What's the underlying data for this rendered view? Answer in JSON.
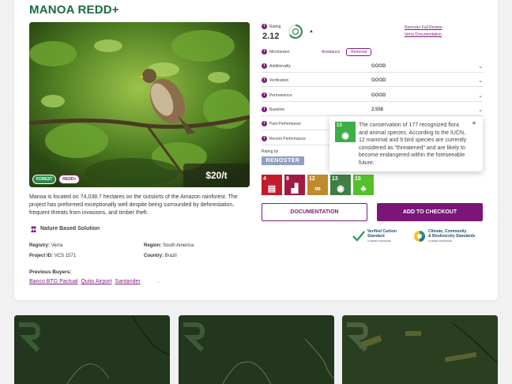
{
  "project": {
    "title": "MANOA REDD+",
    "price": "$20/t",
    "tags": [
      "FOREST",
      "REDD+"
    ],
    "description": "Manoa is located on 74,038.7 hectares on the outskirts of the Amazon rainforest. The project has preformed exceptionally well despite being surrounded by deforestation, frequent threats from invasions, and timber theft.",
    "solution_type": "Nature Based Solution",
    "details": {
      "registry_label": "Registry:",
      "registry": "Verra",
      "region_label": "Region:",
      "region": "South America",
      "project_id_label": "Project ID:",
      "project_id": "VCS 1571",
      "country_label": "Country:",
      "country": "Brazil"
    },
    "buyers_title": "Previous Buyers:",
    "buyers": [
      "Banco BTG Pactual",
      "Quito Airport",
      "Santander",
      "."
    ]
  },
  "rating": {
    "label": "Rating",
    "value": "2.12",
    "links": [
      "Renoster Full Review",
      "Verra Documentation"
    ],
    "mechanism_label": "Mechanism",
    "mechanism_options": [
      "Avoidance",
      "Removal"
    ],
    "rows": [
      {
        "label": "Additionality",
        "value": "GOOD"
      },
      {
        "label": "Verification",
        "value": "GOOD"
      },
      {
        "label": "Permanence",
        "value": "GOOD"
      },
      {
        "label": "Baseline",
        "value": "2.558"
      },
      {
        "label": "Past Performance",
        "value": ""
      },
      {
        "label": "Recent Performance",
        "value": ""
      }
    ],
    "rating_by_label": "Rating by",
    "rating_by": "RENOSTER"
  },
  "sdgs": [
    {
      "number": "4",
      "color": "#c5192d",
      "icon": "book-icon"
    },
    {
      "number": "8",
      "color": "#a21942",
      "icon": "growth-chart-icon"
    },
    {
      "number": "12",
      "color": "#bf8b2e",
      "icon": "infinity-icon"
    },
    {
      "number": "13",
      "color": "#3f7e44",
      "icon": "eye-globe-icon"
    },
    {
      "number": "15",
      "color": "#56c02b",
      "icon": "tree-icon"
    }
  ],
  "popup": {
    "sdg_number": "13",
    "text": "The conservation of 177 recognized flora and animal species. According to the IUCN, 12 mammal and 9 bird species are currently considered as \"threatened\" and are likely to become endangered within the foreseeable future.",
    "close": "×"
  },
  "actions": {
    "documentation": "DOCUMENTATION",
    "checkout": "ADD TO CHECKOUT"
  },
  "standards": {
    "vcs": [
      "Verified Carbon",
      "Standard",
      "A VERRA STANDARD"
    ],
    "ccb": [
      "Climate, Community",
      "& Biodiversity Standards",
      "A VERRA STANDARD"
    ]
  },
  "colors": {
    "brand_green": "#1c6b40",
    "accent_purple": "#7a1678",
    "renoster": "#8fa0c4"
  }
}
